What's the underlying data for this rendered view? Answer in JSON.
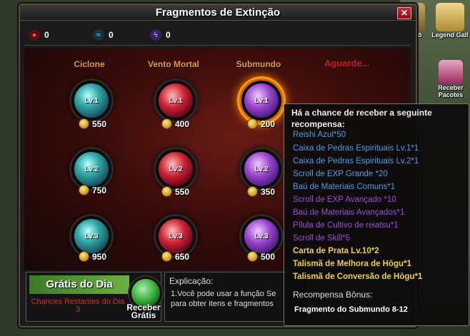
{
  "window": {
    "title": "Fragmentos de Extinção",
    "close_label": "✕"
  },
  "resources": [
    {
      "icon": "flame-icon",
      "value": "0",
      "color": "#e23"
    },
    {
      "icon": "wind-icon",
      "value": "0",
      "color": "#2aa"
    },
    {
      "icon": "lightning-icon",
      "value": "0",
      "color": "#94e"
    }
  ],
  "columns": [
    {
      "name": "Ciclone",
      "color": "blue",
      "orbs": [
        {
          "level": "Lv.1",
          "price": "550"
        },
        {
          "level": "Lv.2",
          "price": "750"
        },
        {
          "level": "Lv.3",
          "price": "950"
        }
      ]
    },
    {
      "name": "Vento Mortal",
      "color": "red",
      "orbs": [
        {
          "level": "Lv.1",
          "price": "400"
        },
        {
          "level": "Lv.2",
          "price": "550"
        },
        {
          "level": "Lv.3",
          "price": "650"
        }
      ]
    },
    {
      "name": "Submundo",
      "color": "purple",
      "orbs": [
        {
          "level": "Lv.1",
          "price": "200"
        },
        {
          "level": "Lv.2",
          "price": "350"
        },
        {
          "level": "Lv.3",
          "price": "500"
        }
      ]
    }
  ],
  "waiting_label": "Aguarde...",
  "side_icons": {
    "partial_label": "eiô",
    "legend": "Legend Gall",
    "receive_packs": "Receber Pacotes"
  },
  "daily": {
    "title": "Grátis do Dia",
    "chances_label": "Chances Restantes do Dia 3",
    "receive_label": "Receber Grátis"
  },
  "explanation": {
    "title": "Explicação:",
    "line1": "1.Você pode usar a função Se",
    "line2": "para obter itens e fragmentos"
  },
  "tooltip": {
    "header": "Há a chance de receber a seguinte recompensa:",
    "items": [
      {
        "text": "Reishi Azul*50",
        "color": "#4a9fe8"
      },
      {
        "text": "Caixa de Pedras Espirituais Lv.1*1",
        "color": "#4a9fe8"
      },
      {
        "text": "Caixa de Pedras Espirituais Lv.2*1",
        "color": "#4a9fe8"
      },
      {
        "text": "Scroll de EXP Grande *20",
        "color": "#4a9fe8"
      },
      {
        "text": "Baú de Materiais Comuns*1",
        "color": "#4a9fe8"
      },
      {
        "text": "Scroll de EXP Avançado *10",
        "color": "#9a4ed8"
      },
      {
        "text": "Baú de Materiais Avançados*1",
        "color": "#9a4ed8"
      },
      {
        "text": "Pílula de Cultivo de reiatsu*1",
        "color": "#9a4ed8"
      },
      {
        "text": "Scroll de Skill*5",
        "color": "#9a4ed8"
      },
      {
        "text": "Carta de Prata Lv.10*2",
        "color": "#f0d040"
      },
      {
        "text": "Talismã de Melhora de Hōgu*1",
        "color": "#f0d040"
      },
      {
        "text": "Talismã de Conversão de Hōgu*1",
        "color": "#f0d040"
      }
    ],
    "bonus_header": "Recompensa Bônus:",
    "bonus_item": "Fragmento do Submundo 8-12"
  }
}
